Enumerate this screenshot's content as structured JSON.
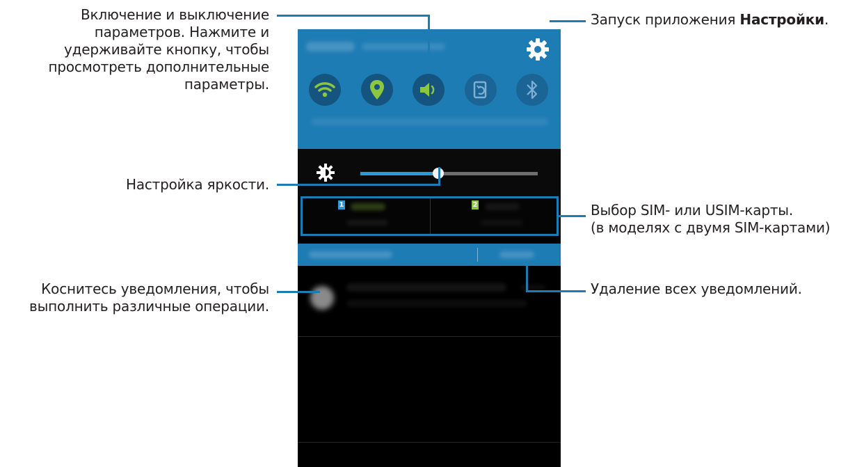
{
  "callouts": {
    "toggles": {
      "line1": "Включение и выключение",
      "line2": "параметров. Нажмите и",
      "line3": "удерживайте кнопку, чтобы",
      "line4": "просмотреть дополнительные",
      "line5": "параметры."
    },
    "brightness": "Настройка яркости.",
    "notification": {
      "line1": "Коснитесь уведомления, чтобы",
      "line2": "выполнить различные операции."
    },
    "settings": {
      "prefix": "Запуск приложения ",
      "bold": "Настройки",
      "suffix": "."
    },
    "sim": {
      "line1": "Выбор SIM- или USIM-карты.",
      "line2": "(в моделях с двумя SIM-картами)"
    },
    "clear": "Удаление всех уведомлений."
  },
  "phone": {
    "toggles": [
      {
        "icon": "wifi-icon",
        "color": "#8dc63f"
      },
      {
        "icon": "location-icon",
        "color": "#8dc63f"
      },
      {
        "icon": "sound-icon",
        "color": "#8dc63f"
      },
      {
        "icon": "screen-rotation-icon",
        "color": "#7fb0d3"
      },
      {
        "icon": "bluetooth-icon",
        "color": "#7fb0d3"
      }
    ],
    "brightness_level": 0.44,
    "sim": [
      {
        "badge": "1",
        "color": "#2a9ad8"
      },
      {
        "badge": "2",
        "color": "#8dc63f"
      }
    ]
  },
  "colors": {
    "accent": "#1e7cb5",
    "active_icon": "#8dc63f"
  }
}
